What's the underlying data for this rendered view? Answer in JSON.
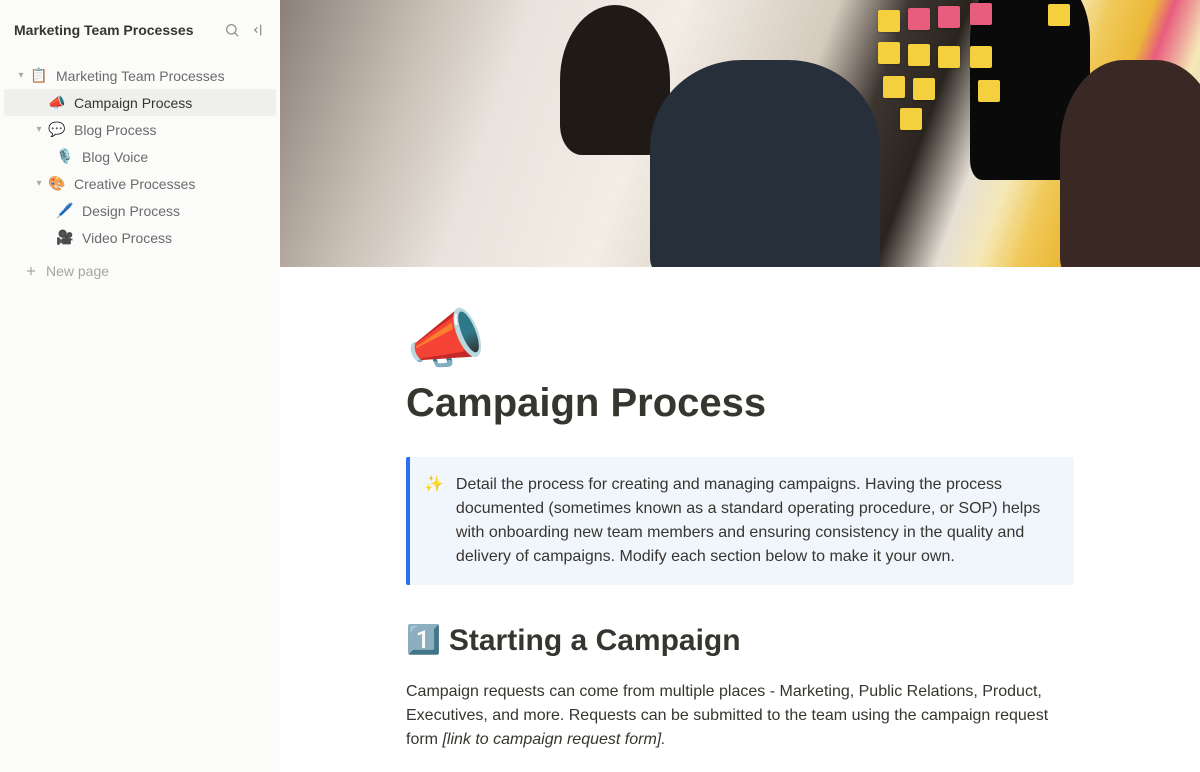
{
  "workspace": {
    "title": "Marketing Team Processes"
  },
  "sidebar": {
    "new_page_label": "New page",
    "items": [
      {
        "icon": "📋",
        "label": "Marketing Team Processes",
        "level": 0,
        "expanded": true,
        "active": false,
        "has_children": true
      },
      {
        "icon": "📣",
        "label": "Campaign Process",
        "level": 1,
        "expanded": false,
        "active": true,
        "has_children": false
      },
      {
        "icon": "💬",
        "label": "Blog Process",
        "level": 1,
        "expanded": true,
        "active": false,
        "has_children": true
      },
      {
        "icon": "🎙️",
        "label": "Blog Voice",
        "level": 2,
        "expanded": false,
        "active": false,
        "has_children": false
      },
      {
        "icon": "🎨",
        "label": "Creative Processes",
        "level": 1,
        "expanded": true,
        "active": false,
        "has_children": true
      },
      {
        "icon": "🖊️",
        "label": "Design Process",
        "level": 2,
        "expanded": false,
        "active": false,
        "has_children": false
      },
      {
        "icon": "🎥",
        "label": "Video Process",
        "level": 2,
        "expanded": false,
        "active": false,
        "has_children": false
      }
    ]
  },
  "page": {
    "emoji": "📣",
    "title": "Campaign Process",
    "callout_icon": "✨",
    "callout_text": "Detail the process for creating and managing campaigns. Having the process documented (sometimes known as a standard operating procedure, or SOP) helps with onboarding new team members and ensuring consistency in the quality and delivery of campaigns. Modify each section below to make it your own.",
    "section1_emoji": "1️⃣",
    "section1_title": "Starting a Campaign",
    "section1_body": "Campaign requests can come from multiple places - Marketing, Public Relations, Product, Executives, and more. Requests can be submitted to the team using the campaign request form ",
    "section1_link": "[link to campaign request form]."
  }
}
